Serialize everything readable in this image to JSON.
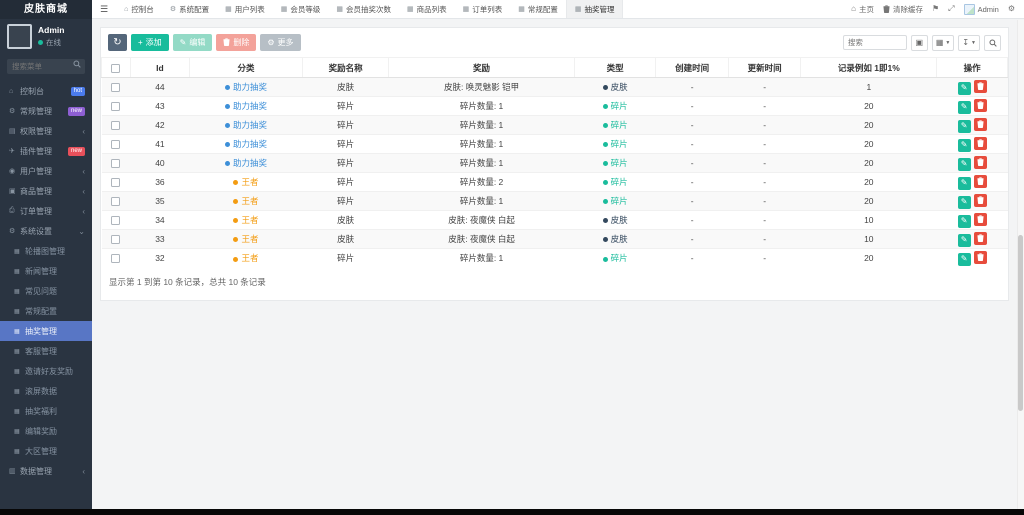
{
  "app": {
    "brand": "皮肤商城",
    "colors": {
      "primary": "#18bc9c",
      "danger": "#e74c3c",
      "active_menu": "#5876c5",
      "category_blue": "#3d8fd8",
      "category_orange": "#f39c12",
      "type_dark": "#34495e",
      "type_teal": "#1abc9c"
    }
  },
  "sidebar": {
    "user": {
      "name": "Admin",
      "status": "在线"
    },
    "search_placeholder": "搜索菜单",
    "menu": [
      {
        "key": "dashboard",
        "label": "控制台",
        "icon": "dashboard-icon",
        "badge": "hot",
        "badge_color": "#4b7bec"
      },
      {
        "key": "general",
        "label": "常规管理",
        "icon": "gears-icon",
        "badge": "new",
        "badge_color": "#8e5fd3"
      },
      {
        "key": "auth",
        "label": "权限管理",
        "icon": "users-icon",
        "chevron": "left"
      },
      {
        "key": "addon",
        "label": "插件管理",
        "icon": "plane-icon",
        "badge": "new",
        "badge_color": "#e8505b"
      },
      {
        "key": "user",
        "label": "用户管理",
        "icon": "user-icon",
        "chevron": "left"
      },
      {
        "key": "goods",
        "label": "商品管理",
        "icon": "goods-icon",
        "chevron": "left"
      },
      {
        "key": "order",
        "label": "订单管理",
        "icon": "printer-icon",
        "chevron": "left"
      },
      {
        "key": "system",
        "label": "系统设置",
        "icon": "gear-icon",
        "chevron": "down",
        "active_child": "抽奖管理",
        "children": [
          {
            "key": "banner",
            "label": "轮播图管理"
          },
          {
            "key": "news",
            "label": "新闻管理"
          },
          {
            "key": "faq",
            "label": "常见问题"
          },
          {
            "key": "config",
            "label": "常规配置"
          },
          {
            "key": "lottery",
            "label": "抽奖管理"
          },
          {
            "key": "service",
            "label": "客服管理"
          },
          {
            "key": "invite-reward",
            "label": "邀请好友奖励"
          },
          {
            "key": "scroll-data",
            "label": "滚屏数据"
          },
          {
            "key": "lottery-welfare",
            "label": "抽奖福利"
          },
          {
            "key": "edit-reward",
            "label": "编辑奖励"
          },
          {
            "key": "region",
            "label": "大区管理"
          }
        ]
      },
      {
        "key": "database",
        "label": "数据管理",
        "icon": "database-icon",
        "chevron": "left"
      }
    ]
  },
  "topnav": {
    "tabs": [
      {
        "key": "dashboard",
        "label": "控制台",
        "icon": "home-icon"
      },
      {
        "key": "system-config",
        "label": "系统配置",
        "icon": "gear-icon"
      },
      {
        "key": "user-list",
        "label": "用户列表",
        "icon": "table-icon"
      },
      {
        "key": "member-level",
        "label": "会员等级",
        "icon": "table-icon"
      },
      {
        "key": "member-lottery-times",
        "label": "会员抽奖次数",
        "icon": "table-icon"
      },
      {
        "key": "goods-list",
        "label": "商品列表",
        "icon": "table-icon"
      },
      {
        "key": "order-list",
        "label": "订单列表",
        "icon": "table-icon"
      },
      {
        "key": "general-config",
        "label": "常规配置",
        "icon": "table-icon"
      },
      {
        "key": "lottery-manage",
        "label": "抽奖管理",
        "icon": "table-icon",
        "active": true
      }
    ],
    "right": {
      "home_label": "主页",
      "clear_cache_label": "清除缓存",
      "username": "Admin"
    }
  },
  "toolbar": {
    "add_label": "添加",
    "edit_label": "编辑",
    "delete_label": "删除",
    "more_label": "更多",
    "search_placeholder": "搜索"
  },
  "table": {
    "columns": [
      "Id",
      "分类",
      "奖励名称",
      "奖励",
      "类型",
      "创建时间",
      "更新时间",
      "记录例如 1即1%",
      "操作"
    ],
    "rows": [
      {
        "id": "44",
        "category": "助力抽奖",
        "category_color": "#3d8fd8",
        "reward_name": "皮肤",
        "reward": "皮肤: 唤灵魅影 铠甲",
        "type": "皮肤",
        "type_color": "#34495e",
        "created": "-",
        "updated": "-",
        "rate": "1"
      },
      {
        "id": "43",
        "category": "助力抽奖",
        "category_color": "#3d8fd8",
        "reward_name": "碎片",
        "reward": "碎片数量: 1",
        "type": "碎片",
        "type_color": "#1abc9c",
        "created": "-",
        "updated": "-",
        "rate": "20"
      },
      {
        "id": "42",
        "category": "助力抽奖",
        "category_color": "#3d8fd8",
        "reward_name": "碎片",
        "reward": "碎片数量: 1",
        "type": "碎片",
        "type_color": "#1abc9c",
        "created": "-",
        "updated": "-",
        "rate": "20"
      },
      {
        "id": "41",
        "category": "助力抽奖",
        "category_color": "#3d8fd8",
        "reward_name": "碎片",
        "reward": "碎片数量: 1",
        "type": "碎片",
        "type_color": "#1abc9c",
        "created": "-",
        "updated": "-",
        "rate": "20"
      },
      {
        "id": "40",
        "category": "助力抽奖",
        "category_color": "#3d8fd8",
        "reward_name": "碎片",
        "reward": "碎片数量: 1",
        "type": "碎片",
        "type_color": "#1abc9c",
        "created": "-",
        "updated": "-",
        "rate": "20"
      },
      {
        "id": "36",
        "category": "王者",
        "category_color": "#f39c12",
        "reward_name": "碎片",
        "reward": "碎片数量: 2",
        "type": "碎片",
        "type_color": "#1abc9c",
        "created": "-",
        "updated": "-",
        "rate": "20"
      },
      {
        "id": "35",
        "category": "王者",
        "category_color": "#f39c12",
        "reward_name": "碎片",
        "reward": "碎片数量: 1",
        "type": "碎片",
        "type_color": "#1abc9c",
        "created": "-",
        "updated": "-",
        "rate": "20"
      },
      {
        "id": "34",
        "category": "王者",
        "category_color": "#f39c12",
        "reward_name": "皮肤",
        "reward": "皮肤: 夜魔侠 白起",
        "type": "皮肤",
        "type_color": "#34495e",
        "created": "-",
        "updated": "-",
        "rate": "10"
      },
      {
        "id": "33",
        "category": "王者",
        "category_color": "#f39c12",
        "reward_name": "皮肤",
        "reward": "皮肤: 夜魔侠 白起",
        "type": "皮肤",
        "type_color": "#34495e",
        "created": "-",
        "updated": "-",
        "rate": "10"
      },
      {
        "id": "32",
        "category": "王者",
        "category_color": "#f39c12",
        "reward_name": "碎片",
        "reward": "碎片数量: 1",
        "type": "碎片",
        "type_color": "#1abc9c",
        "created": "-",
        "updated": "-",
        "rate": "20"
      }
    ],
    "footer": "显示第 1 到第 10 条记录，总共 10 条记录"
  }
}
